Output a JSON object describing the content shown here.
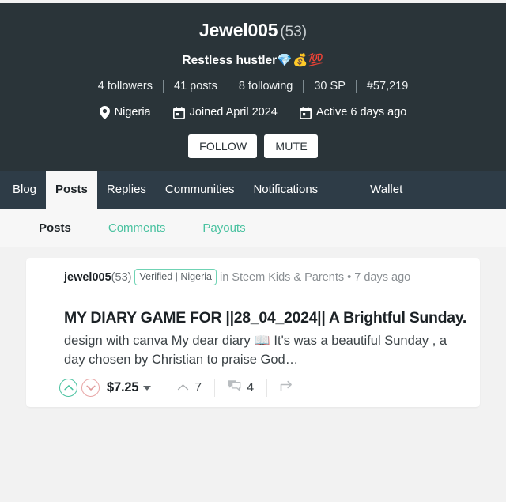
{
  "profile": {
    "display_name": "Jewel005",
    "reputation": "(53)",
    "bio_text": "Restless hustler",
    "bio_emoji": "💎💰💯",
    "stats": [
      {
        "label": "4 followers",
        "name": "followers"
      },
      {
        "label": "41 posts",
        "name": "posts"
      },
      {
        "label": "8 following",
        "name": "following"
      },
      {
        "label": "30 SP",
        "name": "steem-power"
      },
      {
        "label": "#57,219",
        "name": "rank"
      }
    ],
    "meta": [
      {
        "icon": "location-pin-icon",
        "label": "Nigeria",
        "name": "location"
      },
      {
        "icon": "calendar-icon",
        "label": "Joined April 2024",
        "name": "joined-date"
      },
      {
        "icon": "calendar-icon",
        "label": "Active 6 days ago",
        "name": "last-active"
      }
    ],
    "follow_label": "FOLLOW",
    "mute_label": "MUTE"
  },
  "main_tabs": [
    {
      "label": "Blog",
      "name": "tab-blog",
      "active": false
    },
    {
      "label": "Posts",
      "name": "tab-posts",
      "active": true
    },
    {
      "label": "Replies",
      "name": "tab-replies",
      "active": false
    },
    {
      "label": "Communities",
      "name": "tab-communities",
      "active": false
    },
    {
      "label": "Notifications",
      "name": "tab-notifications",
      "active": false
    },
    {
      "label": "Wallet",
      "name": "tab-wallet",
      "active": false
    }
  ],
  "sub_tabs": [
    {
      "label": "Posts",
      "name": "subtab-posts",
      "active": true
    },
    {
      "label": "Comments",
      "name": "subtab-comments",
      "active": false
    },
    {
      "label": "Payouts",
      "name": "subtab-payouts",
      "active": false
    }
  ],
  "post": {
    "author": "jewel005",
    "author_reputation": "(53)",
    "verified_badge": "Verified | Nigeria",
    "community_line": "in Steem Kids & Parents • 7 days ago",
    "title": "MY DIARY GAME FOR ||28_04_2024|| A Brightful Sunday.",
    "summary": "design with canva My dear diary 📖 It's was a beautiful Sunday , a day chosen by Christian to praise God…",
    "payout": "$7.25",
    "vote_count": "7",
    "comment_count": "4"
  },
  "colors": {
    "header_bg": "#2a3439",
    "tabbar_bg": "#2e3c47",
    "accent_teal": "#4ac2a0",
    "downvote_pink": "#e8a6a6",
    "page_bg": "#f2f2f2"
  }
}
